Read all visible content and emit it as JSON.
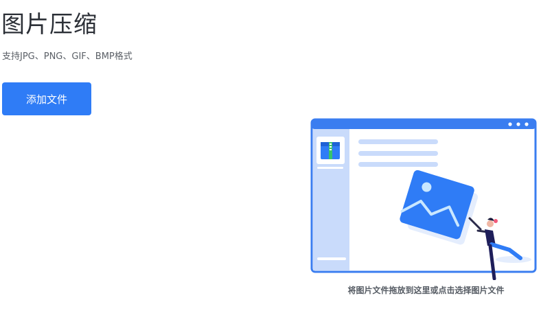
{
  "header": {
    "title": "图片压缩",
    "subtitle": "支持JPG、PNG、GIF、BMP格式"
  },
  "toolbar": {
    "add_file_label": "添加文件"
  },
  "dropzone": {
    "hint": "将图片文件拖放到这里或点击选择图片文件"
  },
  "colors": {
    "accent": "#2f7cf6",
    "panel": "#c9dbfb",
    "window_frame": "#3a7df0"
  }
}
